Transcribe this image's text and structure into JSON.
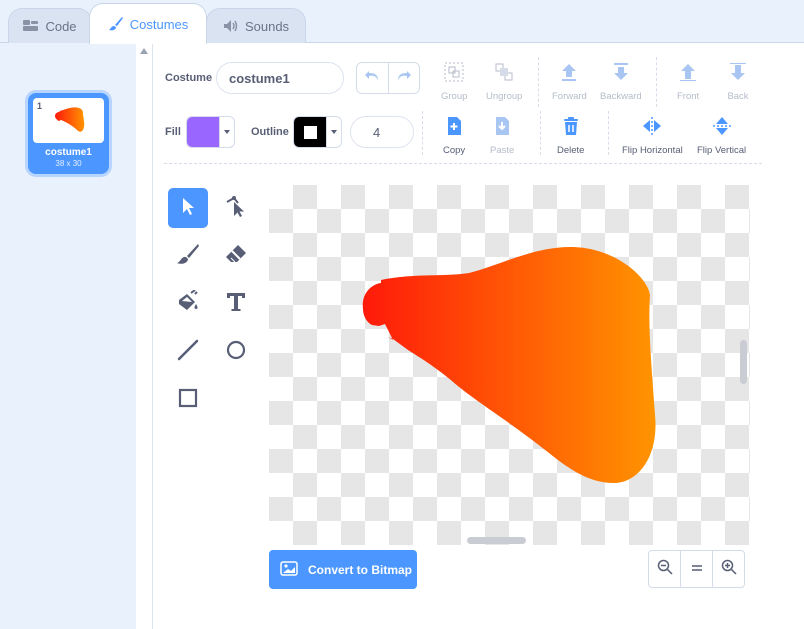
{
  "tabs": [
    {
      "label": "Code",
      "icon": "code-icon"
    },
    {
      "label": "Costumes",
      "icon": "brush-icon"
    },
    {
      "label": "Sounds",
      "icon": "speaker-icon"
    }
  ],
  "active_tab": "Costumes",
  "costumes": [
    {
      "number": "1",
      "name": "costume1",
      "size": "38 x 30"
    }
  ],
  "editor": {
    "costume_label": "Costume",
    "costume_name": "costume1",
    "fill_label": "Fill",
    "fill_color": "#9966ff",
    "outline_label": "Outline",
    "outline_color": "#000000",
    "outline_width": "4",
    "toolbar": {
      "group": "Group",
      "ungroup": "Ungroup",
      "forward": "Forward",
      "backward": "Backward",
      "front": "Front",
      "back": "Back",
      "copy": "Copy",
      "paste": "Paste",
      "delete": "Delete",
      "flip_horizontal": "Flip Horizontal",
      "flip_vertical": "Flip Vertical"
    },
    "tools": [
      "select-tool",
      "reshape-tool",
      "brush-tool",
      "eraser-tool",
      "fill-tool",
      "text-tool",
      "line-tool",
      "circle-tool",
      "rectangle-tool"
    ],
    "selected_tool": "select-tool",
    "convert_button": "Convert to Bitmap",
    "zoom_buttons": [
      "zoom-out",
      "zoom-reset",
      "zoom-in"
    ]
  },
  "colors": {
    "accent": "#4c97ff",
    "shape_gradient_start": "#ff1a0a",
    "shape_gradient_end": "#ff9400"
  }
}
